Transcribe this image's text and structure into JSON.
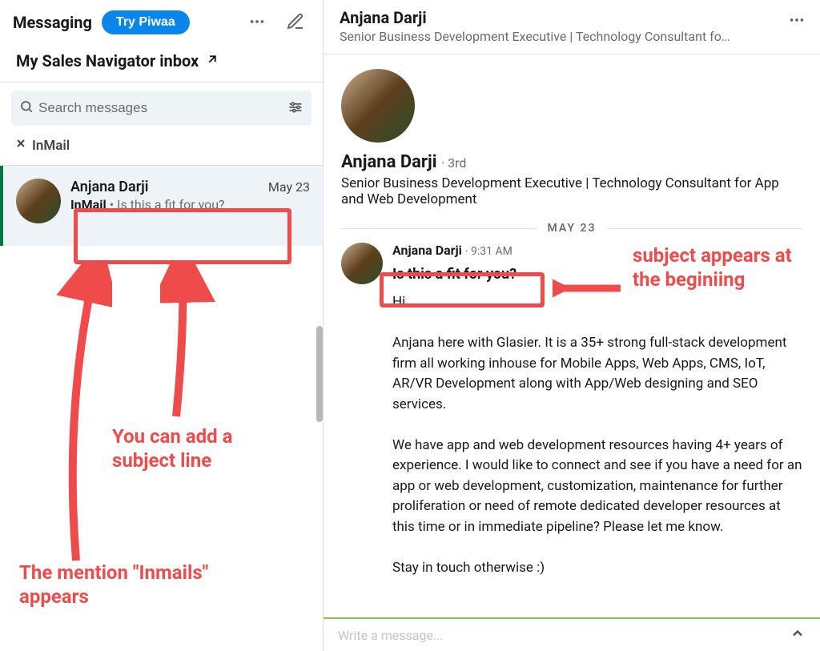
{
  "sidebar": {
    "title": "Messaging",
    "try_button": "Try Piwaa",
    "subheader": "My Sales Navigator inbox",
    "search_placeholder": "Search messages",
    "filter_chip": "InMail"
  },
  "conversations": [
    {
      "name": "Anjana Darji",
      "date": "May 23",
      "badge": "InMail",
      "preview": "Is this a fit for you?"
    }
  ],
  "thread_header": {
    "name": "Anjana Darji",
    "subtitle": "Senior Business Development Executive | Technology Consultant fo…"
  },
  "profile": {
    "name": "Anjana Darji",
    "degree": "3rd",
    "subtitle": "Senior Business Development Executive | Technology Consultant for App and Web Development"
  },
  "thread": {
    "date_divider": "MAY 23",
    "sender": "Anjana Darji",
    "time": "9:31 AM",
    "subject": "Is this a fit for you?",
    "body": "Hi,\n\nAnjana here with Glasier. It is a 35+ strong full-stack development firm all working inhouse for Mobile Apps, Web Apps, CMS, IoT, AR/VR Development along with App/Web designing and SEO services.\n\nWe have app and web development resources having 4+ years of experience. I would like to connect and see if you have a need for an app or web development, customization, maintenance for further proliferation or need of remote dedicated developer resources at this time or in immediate pipeline? Please let me know.\n\nStay in touch otherwise :)"
  },
  "composer": {
    "placeholder": "Write a message..."
  },
  "annotations": {
    "left_1": "You can add a subject line",
    "left_2": "The mention \"Inmails\" appears",
    "right_1": "subject appears at the beginiing"
  }
}
